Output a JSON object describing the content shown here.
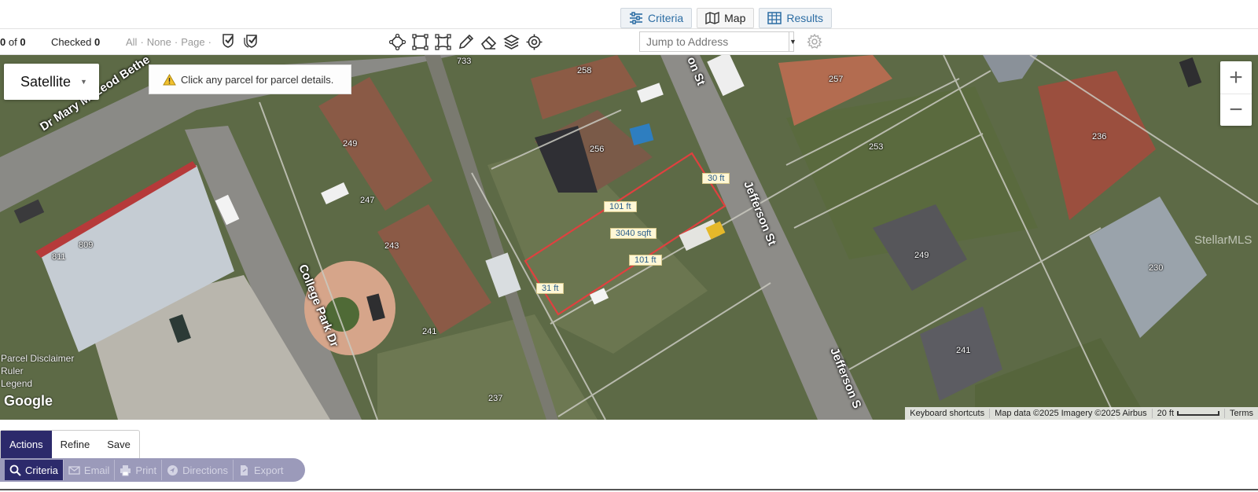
{
  "tabs": [
    {
      "label": "Criteria",
      "icon": "sliders-icon"
    },
    {
      "label": "Map",
      "icon": "map-icon"
    },
    {
      "label": "Results",
      "icon": "table-icon"
    }
  ],
  "toolbar": {
    "count_current": "0",
    "count_of": "of",
    "count_total": "0",
    "checked_label": "Checked",
    "checked_count": "0",
    "select_all": "All",
    "select_none": "None",
    "select_page": "Page",
    "jump_placeholder": "Jump to Address"
  },
  "map": {
    "map_type": "Satellite",
    "info_message": "Click any parcel for parcel details.",
    "zoom_in": "+",
    "zoom_out": "−",
    "measurements": {
      "top_side": "30 ft",
      "long_side_upper": "101 ft",
      "area": "3040 sqft",
      "long_side_lower": "101 ft",
      "bottom_side": "31 ft"
    },
    "parcel_numbers": [
      "733",
      "258",
      "257",
      "249",
      "256",
      "253",
      "236",
      "247",
      "809",
      "811",
      "243",
      "249",
      "230",
      "241",
      "241",
      "237"
    ],
    "streets": {
      "dr_mary": "Dr Mary McLeod Bethe",
      "college_park": "College Park Dr",
      "jefferson_upper": "Jefferson St",
      "jefferson_lower": "Jefferson S",
      "jefferson_top": "on St"
    },
    "left_links": [
      "Parcel Disclaimer",
      "Ruler",
      "Legend"
    ],
    "google_logo": "Google",
    "watermark": "StellarMLS",
    "attribution": {
      "shortcuts": "Keyboard shortcuts",
      "data": "Map data ©2025 Imagery ©2025 Airbus",
      "scale": "20 ft",
      "terms": "Terms"
    },
    "colors": {
      "parcel_outline": "#e0403f",
      "label_bg": "#fff7d6"
    }
  },
  "bottom": {
    "tabs": [
      "Actions",
      "Refine",
      "Save"
    ],
    "actions": [
      "Criteria",
      "Email",
      "Print",
      "Directions",
      "Export"
    ],
    "accent_color": "#2c2a6b"
  }
}
